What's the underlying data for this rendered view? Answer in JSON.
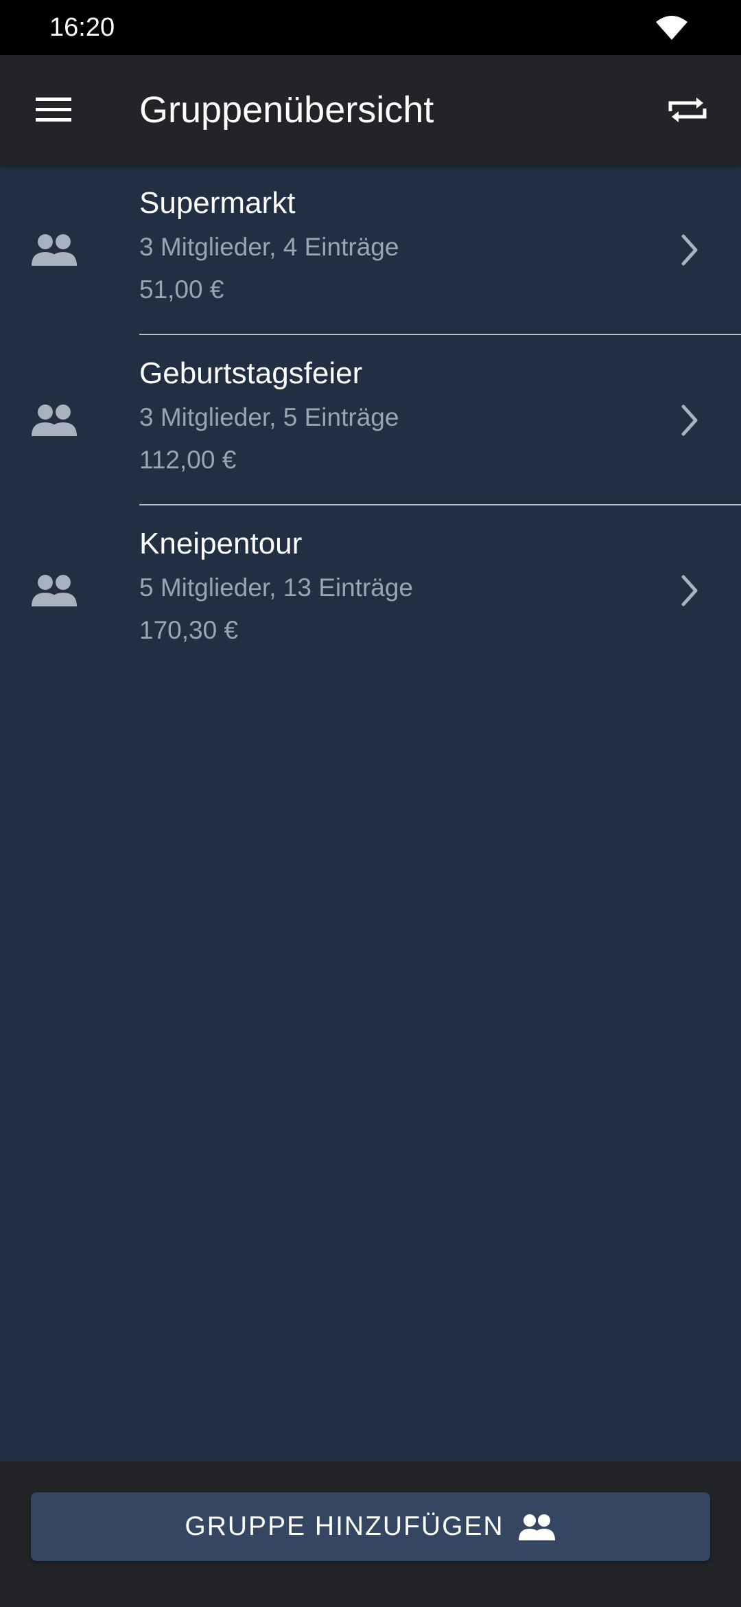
{
  "status_bar": {
    "time": "16:20",
    "wifi_icon": "wifi-icon"
  },
  "app_bar": {
    "title": "Gruppenübersicht",
    "menu_icon": "hamburger-menu-icon",
    "sync_icon": "repeat-sync-icon"
  },
  "groups": [
    {
      "name": "Supermarkt",
      "meta": "3 Mitglieder, 4 Einträge",
      "amount": "51,00 €",
      "icon": "group-people-icon"
    },
    {
      "name": "Geburtstagsfeier",
      "meta": "3 Mitglieder, 5 Einträge",
      "amount": "112,00 €",
      "icon": "group-people-icon"
    },
    {
      "name": "Kneipentour",
      "meta": "5 Mitglieder, 13 Einträge",
      "amount": "170,30 €",
      "icon": "group-people-icon"
    }
  ],
  "bottom": {
    "add_group_label": "GRUPPE HINZUFÜGEN",
    "add_group_icon": "group-add-icon"
  },
  "colors": {
    "background": "#222f42",
    "app_bar": "#232427",
    "button": "#344661",
    "secondary_text": "#9aa4b2"
  }
}
